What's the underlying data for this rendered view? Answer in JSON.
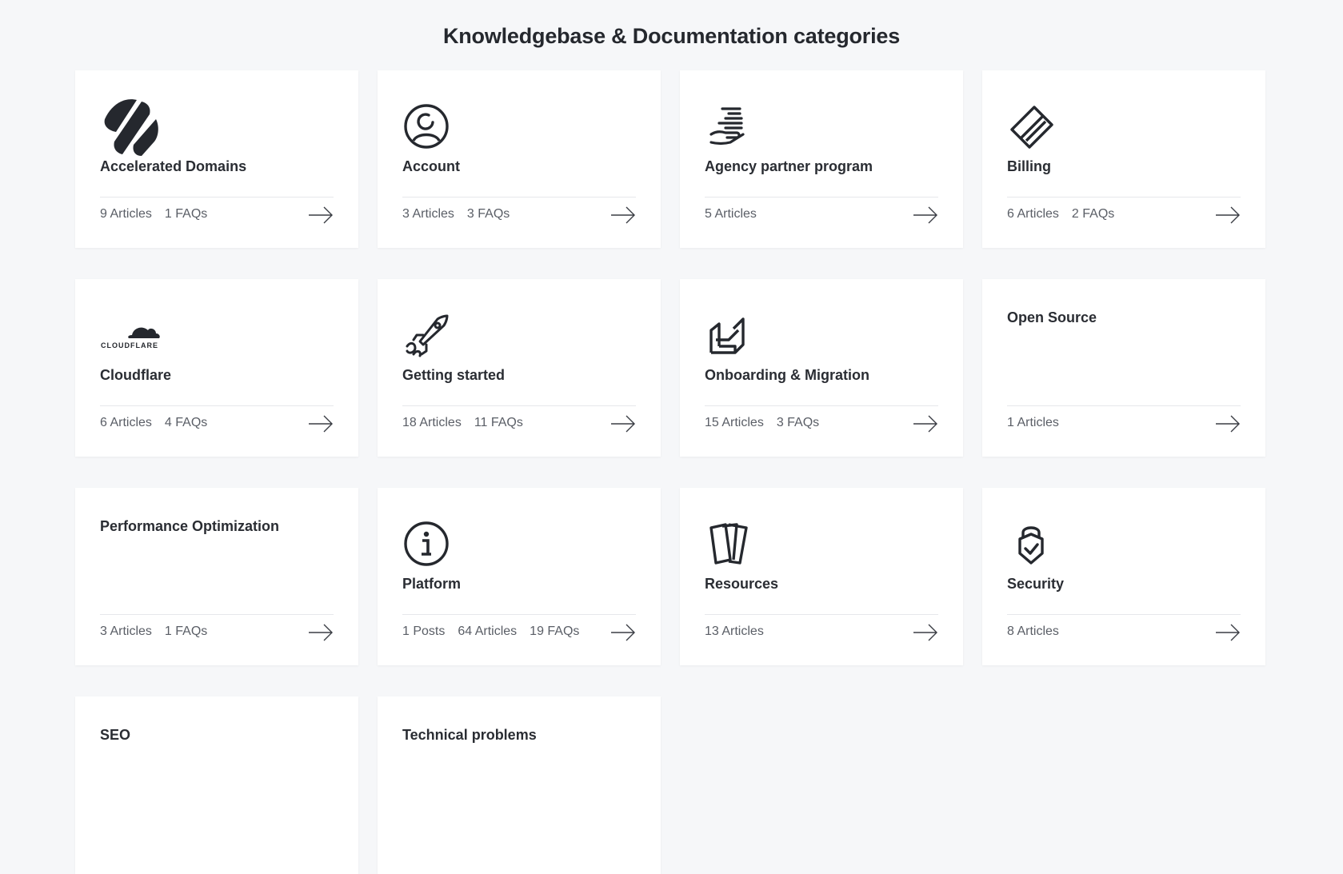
{
  "page": {
    "title": "Knowledgebase & Documentation categories"
  },
  "categories": [
    {
      "title": "Accelerated Domains",
      "icon": "accelerated-domains-icon",
      "stats": [
        "9 Articles",
        "1 FAQs"
      ]
    },
    {
      "title": "Account",
      "icon": "user-circle-icon",
      "stats": [
        "3 Articles",
        "3 FAQs"
      ]
    },
    {
      "title": "Agency partner program",
      "icon": "hand-stack-icon",
      "stats": [
        "5 Articles"
      ]
    },
    {
      "title": "Billing",
      "icon": "credit-card-icon",
      "stats": [
        "6 Articles",
        "2 FAQs"
      ]
    },
    {
      "title": "Cloudflare",
      "icon": "cloudflare-logo",
      "logo_text": "CLOUDFLARE",
      "stats": [
        "6 Articles",
        "4 FAQs"
      ]
    },
    {
      "title": "Getting started",
      "icon": "rocket-icon",
      "stats": [
        "18 Articles",
        "11 FAQs"
      ]
    },
    {
      "title": "Onboarding & Migration",
      "icon": "migration-icon",
      "stats": [
        "15 Articles",
        "3 FAQs"
      ]
    },
    {
      "title": "Open Source",
      "icon": "",
      "stats": [
        "1 Articles"
      ]
    },
    {
      "title": "Performance Optimization",
      "icon": "",
      "stats": [
        "3 Articles",
        "1 FAQs"
      ]
    },
    {
      "title": "Platform",
      "icon": "info-circle-icon",
      "stats": [
        "1 Posts",
        "64 Articles",
        "19 FAQs"
      ]
    },
    {
      "title": "Resources",
      "icon": "cards-icon",
      "stats": [
        "13 Articles"
      ]
    },
    {
      "title": "Security",
      "icon": "padlock-check-icon",
      "stats": [
        "8 Articles"
      ]
    },
    {
      "title": "SEO",
      "icon": "",
      "stats": []
    },
    {
      "title": "Technical problems",
      "icon": "",
      "stats": []
    }
  ],
  "colors": {
    "background": "#f6f7f9",
    "card": "#ffffff",
    "text": "#23262c",
    "muted": "#5a5e66"
  }
}
